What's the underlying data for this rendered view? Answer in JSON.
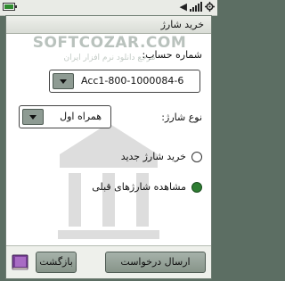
{
  "statusbar": {
    "battery_icon": "battery-icon",
    "speaker_symbol": "◀"
  },
  "watermark": {
    "brand": "SOFTCOZAR.COM",
    "tagline": "مرجع دانلود نرم افزار ایران"
  },
  "window": {
    "title": "خرید شارژ"
  },
  "form": {
    "account_label": "شماره حساب:",
    "account_value": "Acc1-800-1000084-6",
    "charge_type_label": "نوع شارژ:",
    "charge_type_value": "همراه اول",
    "options": [
      {
        "label": "خرید شارژ جدید",
        "selected": false
      },
      {
        "label": "مشاهده شارژهای قبلی",
        "selected": true
      }
    ]
  },
  "toolbar": {
    "send_label": "ارسال درخواست",
    "back_label": "بازگشت"
  },
  "colors": {
    "frame": "#5c6e63",
    "button": "#8e9b93",
    "radio_selected": "#2e7d32"
  }
}
